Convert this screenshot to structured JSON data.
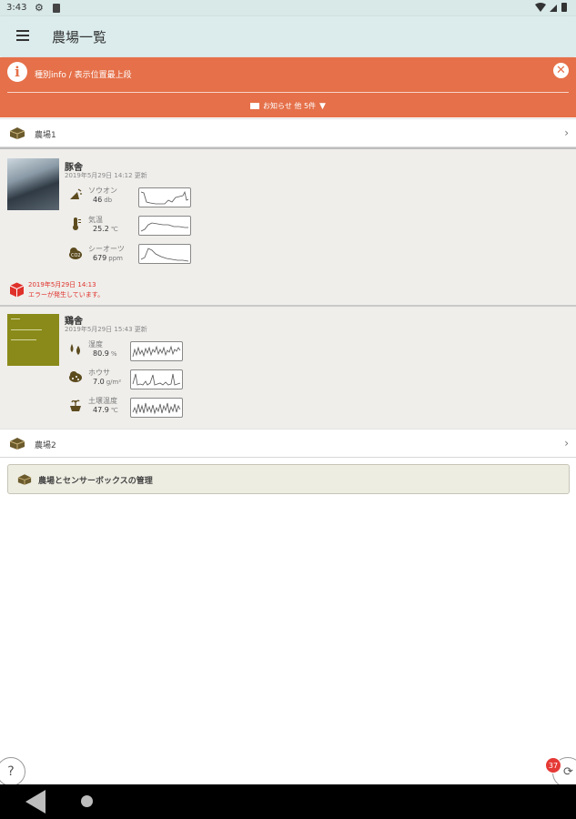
{
  "status_bar": {
    "time": "3:43"
  },
  "app_bar": {
    "title": "農場一覧"
  },
  "notice": {
    "message": "種別info / 表示位置最上段",
    "more_label": "お知らせ 他 5件"
  },
  "farms": [
    {
      "name": "農場1"
    },
    {
      "name": "農場2"
    }
  ],
  "boxes": [
    {
      "name": "豚舎",
      "updated": "2019年5月29日 14:12 更新",
      "readings": [
        {
          "label": "ソウオン",
          "value": "46",
          "unit": "db",
          "icon": "noise-icon"
        },
        {
          "label": "気温",
          "value": "25.2",
          "unit": "℃",
          "icon": "thermometer-icon"
        },
        {
          "label": "シーオーツ",
          "value": "679",
          "unit": "ppm",
          "icon": "co2-icon"
        }
      ],
      "error": {
        "time": "2019年5月29日 14:13",
        "message": "エラーが発生しています。"
      }
    },
    {
      "name": "鶏舎",
      "updated": "2019年5月29日 15:43 更新",
      "readings": [
        {
          "label": "湿度",
          "value": "80.9",
          "unit": "%",
          "icon": "humidity-icon"
        },
        {
          "label": "ホウサ",
          "value": "7.0",
          "unit": "g/m²",
          "icon": "dust-icon"
        },
        {
          "label": "土壌温度",
          "value": "47.9",
          "unit": "℃",
          "icon": "soil-temp-icon"
        }
      ]
    }
  ],
  "manage": {
    "label": "農場とセンサーボックスの管理"
  },
  "fab": {
    "help": "?",
    "sync_badge": "37"
  },
  "colors": {
    "notice_bg": "#e57049",
    "app_bar_bg": "#dcecec",
    "error_red": "#e0302a",
    "badge_red": "#e53935"
  }
}
